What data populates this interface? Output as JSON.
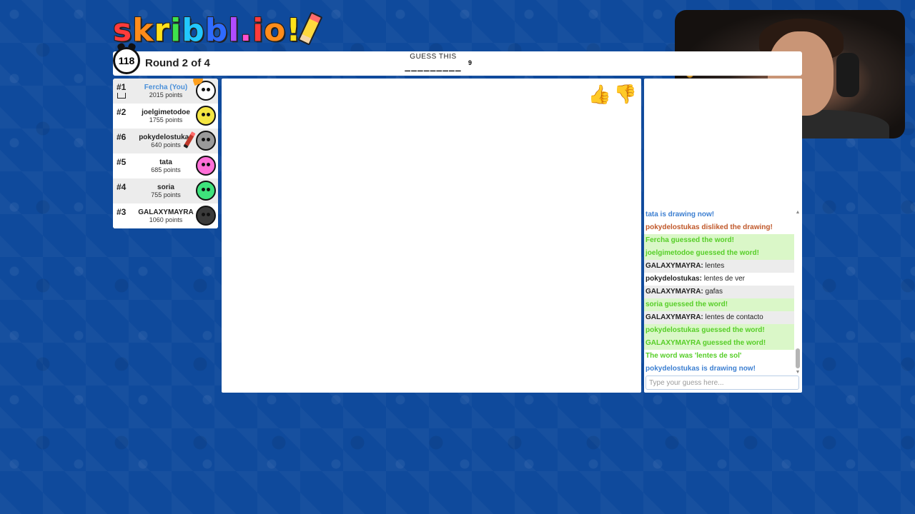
{
  "logo": {
    "letters": [
      "s",
      "k",
      "r",
      "i",
      "b",
      "b",
      "l",
      ".",
      "i",
      "o",
      "!"
    ],
    "colors": [
      "#ff3b3b",
      "#ff8c1a",
      "#ffe11a",
      "#3ee34c",
      "#22c7ff",
      "#2f6bff",
      "#b04cff",
      "#ff4fcf",
      "#ff3b3b",
      "#ff8c1a",
      "#ffe11a"
    ]
  },
  "header": {
    "timer": "118",
    "round": "Round 2 of 4",
    "guess_label": "GUESS THIS",
    "word_blanks": "_________",
    "word_length": "9"
  },
  "players": [
    {
      "rank": "#1",
      "name": "Fercha (You)",
      "points": "2015 points",
      "avatar_color": "#ffffff",
      "is_you": true,
      "has_crown": true
    },
    {
      "rank": "#2",
      "name": "joelgimetodoe",
      "points": "1755 points",
      "avatar_color": "#f5e642"
    },
    {
      "rank": "#6",
      "name": "pokydelostukas",
      "points": "640 points",
      "avatar_color": "#9a9a9a",
      "is_drawing": true
    },
    {
      "rank": "#5",
      "name": "tata",
      "points": "685 points",
      "avatar_color": "#ff6fd8"
    },
    {
      "rank": "#4",
      "name": "soria",
      "points": "755 points",
      "avatar_color": "#3ee37c"
    },
    {
      "rank": "#3",
      "name": "GALAXYMAYRA",
      "points": "1060 points",
      "avatar_color": "#3a3a3a"
    }
  ],
  "vote": {
    "like_icon": "thumbs-up-icon",
    "dislike_icon": "thumbs-down-icon",
    "like_glyph": "👍",
    "dislike_glyph": "👍"
  },
  "chat": {
    "messages": [
      {
        "user": "",
        "text": "tata is drawing now!",
        "color": "#3c7fd1",
        "bg": "none"
      },
      {
        "user": "",
        "text": "pokydelostukas disliked the drawing!",
        "color": "#c0582a",
        "bg": "none"
      },
      {
        "user": "",
        "text": "Fercha guessed the word!",
        "color": "#56ce27",
        "bg": "guessed"
      },
      {
        "user": "",
        "text": "joelgimetodoe guessed the word!",
        "color": "#56ce27",
        "bg": "guessed"
      },
      {
        "user": "GALAXYMAYRA:",
        "text": " lentes",
        "color": "#222222",
        "bg": "alt"
      },
      {
        "user": "pokydelostukas:",
        "text": " lentes de ver",
        "color": "#222222",
        "bg": "none"
      },
      {
        "user": "GALAXYMAYRA:",
        "text": " gafas",
        "color": "#222222",
        "bg": "alt"
      },
      {
        "user": "",
        "text": "soria guessed the word!",
        "color": "#56ce27",
        "bg": "guessed"
      },
      {
        "user": "GALAXYMAYRA:",
        "text": " lentes de contacto",
        "color": "#222222",
        "bg": "alt"
      },
      {
        "user": "",
        "text": "pokydelostukas guessed the word!",
        "color": "#56ce27",
        "bg": "guessed"
      },
      {
        "user": "",
        "text": "GALAXYMAYRA guessed the word!",
        "color": "#56ce27",
        "bg": "guessed"
      },
      {
        "user": "",
        "text": "The word was 'lentes de sol'",
        "color": "#56ce27",
        "bg": "none"
      },
      {
        "user": "",
        "text": "pokydelostukas is drawing now!",
        "color": "#3c7fd1",
        "bg": "none"
      }
    ],
    "input_placeholder": "Type your guess here..."
  }
}
